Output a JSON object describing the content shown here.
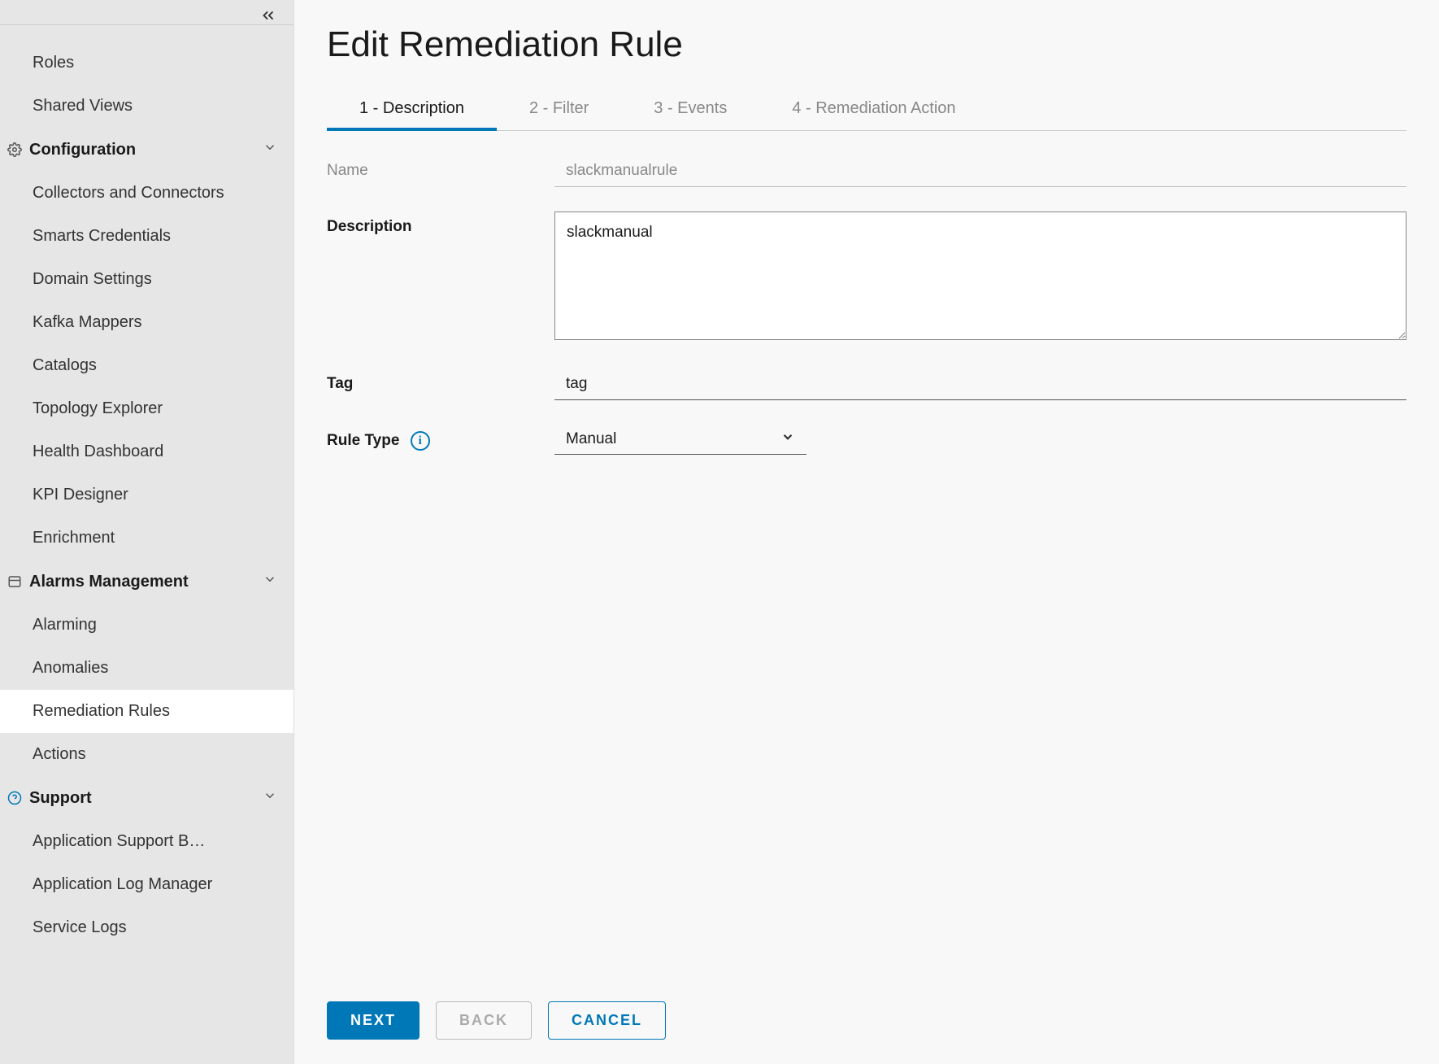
{
  "sidebar": {
    "items": [
      {
        "label": "Roles",
        "type": "item"
      },
      {
        "label": "Shared Views",
        "type": "item"
      }
    ],
    "configuration": {
      "label": "Configuration",
      "items": [
        {
          "label": "Collectors and Connectors"
        },
        {
          "label": "Smarts Credentials"
        },
        {
          "label": "Domain Settings"
        },
        {
          "label": "Kafka Mappers"
        },
        {
          "label": "Catalogs"
        },
        {
          "label": "Topology Explorer"
        },
        {
          "label": "Health Dashboard"
        },
        {
          "label": "KPI Designer"
        },
        {
          "label": "Enrichment"
        }
      ]
    },
    "alarms": {
      "label": "Alarms Management",
      "items": [
        {
          "label": "Alarming"
        },
        {
          "label": "Anomalies"
        },
        {
          "label": "Remediation Rules",
          "active": true
        },
        {
          "label": "Actions"
        }
      ]
    },
    "support": {
      "label": "Support",
      "items": [
        {
          "label": "Application Support Bun..."
        },
        {
          "label": "Application Log Manager"
        },
        {
          "label": "Service Logs"
        }
      ]
    }
  },
  "page": {
    "title": "Edit Remediation Rule",
    "tabs": [
      {
        "label": "1 - Description",
        "active": true
      },
      {
        "label": "2 - Filter"
      },
      {
        "label": "3 - Events"
      },
      {
        "label": "4 - Remediation Action"
      }
    ]
  },
  "form": {
    "name_label": "Name",
    "name_value": "slackmanualrule",
    "description_label": "Description",
    "description_value": "slackmanual",
    "tag_label": "Tag",
    "tag_value": "tag",
    "rule_type_label": "Rule Type",
    "rule_type_value": "Manual"
  },
  "buttons": {
    "next": "NEXT",
    "back": "BACK",
    "cancel": "CANCEL"
  }
}
